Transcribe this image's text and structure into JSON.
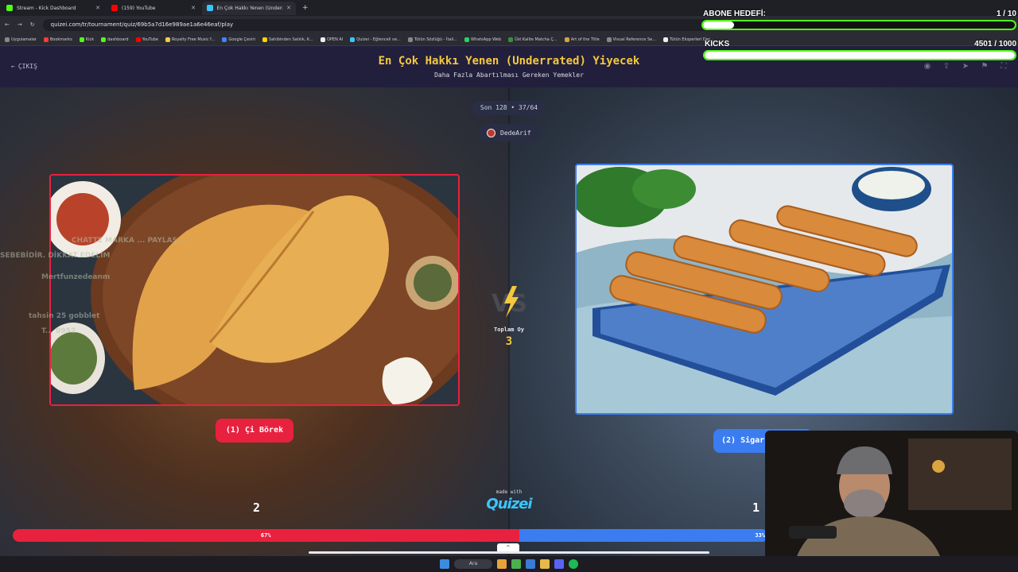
{
  "browser": {
    "tabs": [
      {
        "label": "Stream - Kick Dashboard",
        "color": "#53fc18"
      },
      {
        "label": "(159) YouTube",
        "color": "#ff0000"
      },
      {
        "label": "En Çok Hakkı Yenen (Underrated",
        "color": "#39c6ff"
      }
    ],
    "url": "quizei.com/tr/tournament/quiz/69b5a7d16e989ae1a6e46eaf/play",
    "bookmarks": [
      "Uygulamalar",
      "Bookmarks",
      "Kick",
      "dashboard",
      "YouTube",
      "Royalty Free Music f...",
      "Google Çeviri",
      "Sahibinden Satılık, K...",
      "OPEN AI",
      "Quizei - Eğlenceli ve...",
      "Tütün Sözlüğü - İtali...",
      "WhatsApp Web",
      "Üst Kalite Matcha Ç...",
      "Art of the Title",
      "Visual Reference Se...",
      "Tütün Eksperleri Der..."
    ],
    "other_bookmarks": "Tüm Yer İşaretleri"
  },
  "header": {
    "exit_label": "ÇIKIŞ",
    "title": "En Çok Hakkı Yenen (Underrated) Yiyecek",
    "subtitle": "Daha Fazla Abartılması Gereken Yemekler"
  },
  "round": {
    "label": "Son 128 • 37/64",
    "user": "DedeArif"
  },
  "options": {
    "left": {
      "label": "(1) Çi Börek",
      "votes": "2",
      "percent": "67%",
      "share": 0.67
    },
    "right": {
      "label": "(2) Sigar",
      "votes": "1",
      "percent": "33%",
      "share": 0.33
    }
  },
  "total": {
    "label": "Toplam Oy",
    "value": "3"
  },
  "footer": {
    "made_with": "made with",
    "logo": "Quizei"
  },
  "chat_overlay": [
    "CHATTE MARKA ... PAYLAŞ ... ",
    "SEBEBİDİR. DİKKAT EDELİM",
    "Mertfunzedeanm",
    "tahsin 25 gobblet",
    "T... 0952"
  ],
  "stream_overlay": {
    "abone_label": "ABONE HEDEFİ:",
    "abone_value": "1 / 10",
    "abone_fraction": 0.1,
    "kicks_label": "KICKS",
    "kicks_value": "4501 / 1000",
    "kicks_fraction": 1.0
  },
  "taskbar": {
    "search_label": "Ara"
  },
  "colors": {
    "red": "#e8213f",
    "blue": "#3b7df0",
    "gold": "#f3c93d",
    "kick_green": "#53fc18"
  }
}
